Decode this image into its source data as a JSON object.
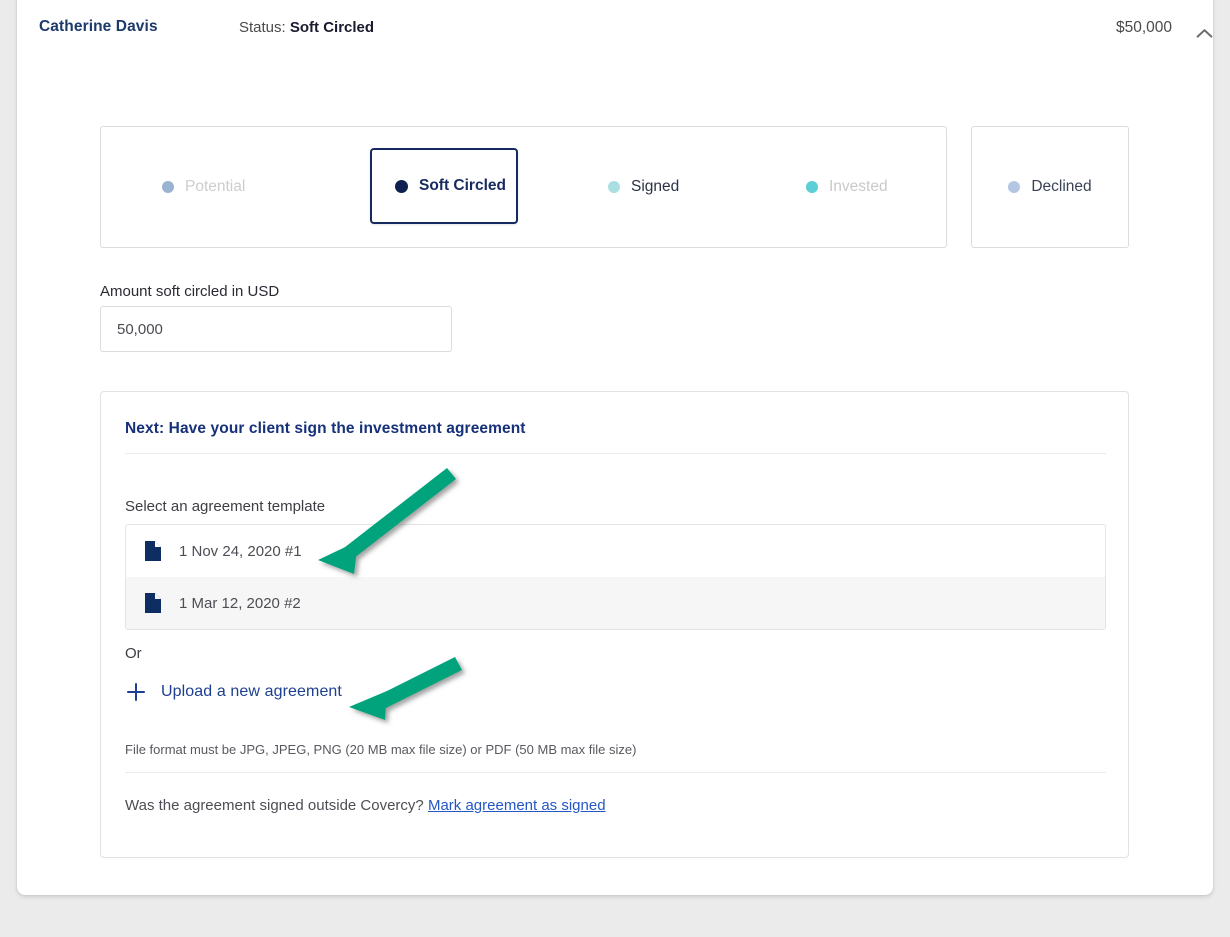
{
  "header": {
    "client_name": "Catherine Davis",
    "status_label": "Status:",
    "status_value": "Soft Circled",
    "amount": "$50,000",
    "collapse_icon": "chevron-up-icon"
  },
  "stepper": {
    "steps": [
      {
        "label": "Potential",
        "dot_color": "#9ab3d0",
        "state": "inactive"
      },
      {
        "label": "Soft Circled",
        "dot_color": "#0d2050",
        "state": "active"
      },
      {
        "label": "Signed",
        "dot_color": "#a9dfe1",
        "state": "inactive"
      },
      {
        "label": "Invested",
        "dot_color": "#5ccfd6",
        "state": "inactive"
      }
    ],
    "declined": {
      "label": "Declined",
      "dot_color": "#b3c6e2"
    }
  },
  "amount_field": {
    "label": "Amount soft circled in USD",
    "value": "50,000",
    "placeholder": "Amount"
  },
  "next_panel": {
    "title": "Next: Have your client sign the investment agreement",
    "select_label": "Select an agreement template",
    "templates": [
      {
        "name": "1 Nov 24, 2020 #1",
        "icon": "document-icon"
      },
      {
        "name": "1 Mar 12, 2020 #2",
        "icon": "document-icon"
      }
    ],
    "or_text": "Or",
    "upload_label": "Upload a new agreement",
    "upload_icon": "plus-icon",
    "file_format_note": "File format must be JPG, JPEG, PNG (20 MB max file size) or PDF (50 MB max file size)",
    "outside_question": "Was the agreement signed outside Covercy?",
    "mark_signed_link": "Mark agreement as signed"
  },
  "annotations": {
    "arrow_color": "#00a37c",
    "arrows": [
      {
        "name": "arrow-to-template-row",
        "points_to": "1 Nov 24, 2020 #1"
      },
      {
        "name": "arrow-to-upload-link",
        "points_to": "Upload a new agreement"
      }
    ]
  },
  "colors": {
    "page_background": "#ebebeb",
    "card_background": "#ffffff",
    "brand_navy": "#16307a",
    "link_blue": "#2457c5",
    "accent_teal": "#00a37c"
  }
}
